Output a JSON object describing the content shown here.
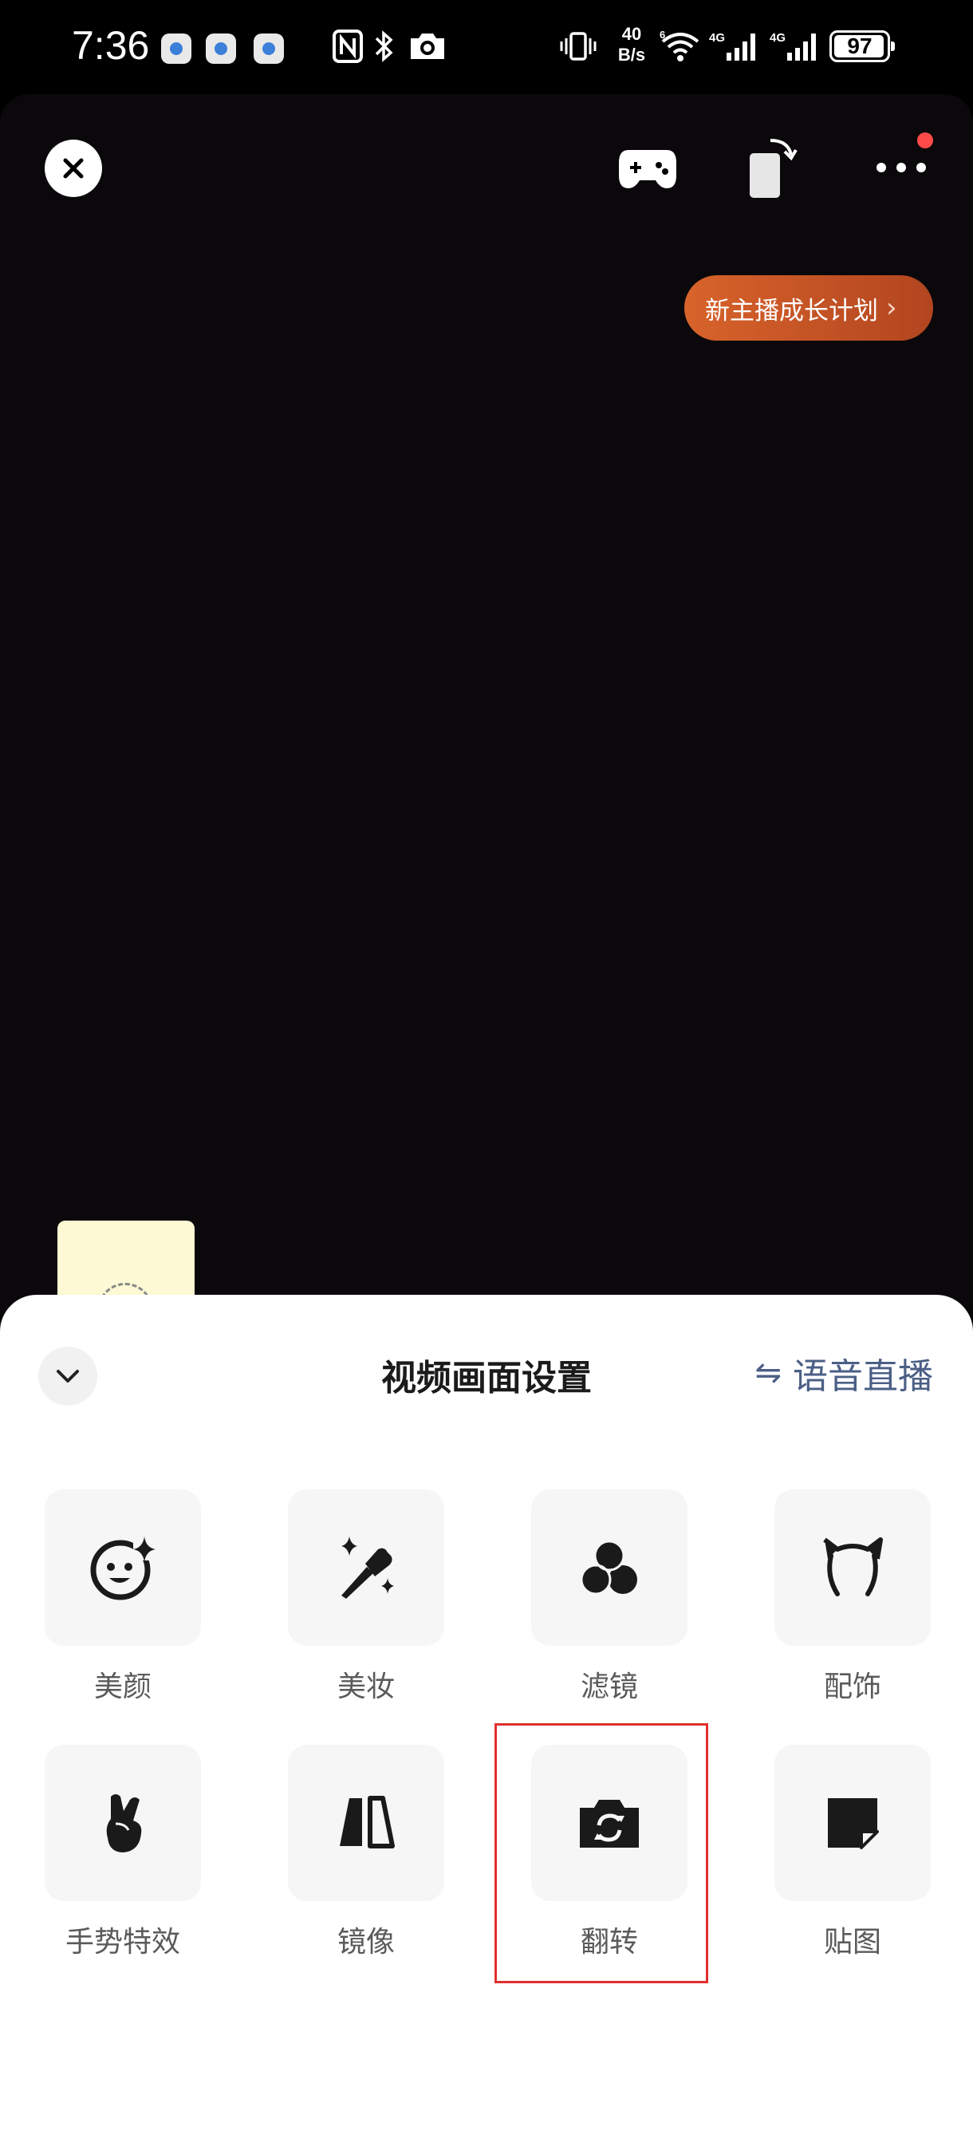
{
  "status_bar": {
    "time": "7:36",
    "net_speed_top": "40",
    "net_speed_bottom": "B/s",
    "wifi_label": "6",
    "sim1_label": "4G",
    "sim2_label": "4G",
    "battery": "97",
    "battery_level": 0.97
  },
  "top_bar": {
    "close_icon": "close-icon",
    "game_icon": "gamepad-icon",
    "rotate_icon": "rotate-screen-icon",
    "more_icon": "more-icon"
  },
  "promo": {
    "label": "新主播成长计划",
    "chevron": "›"
  },
  "sheet": {
    "title": "视频画面设置",
    "switch_label": "语音直播",
    "switch_glyph": "⇋",
    "tools": [
      {
        "label": "美颜",
        "icon": "beauty-face-icon"
      },
      {
        "label": "美妆",
        "icon": "makeup-brush-icon"
      },
      {
        "label": "滤镜",
        "icon": "filter-icon"
      },
      {
        "label": "配饰",
        "icon": "cat-ears-accessory-icon"
      },
      {
        "label": "手势特效",
        "icon": "finger-heart-gesture-icon"
      },
      {
        "label": "镜像",
        "icon": "mirror-icon"
      },
      {
        "label": "翻转",
        "icon": "camera-flip-icon"
      },
      {
        "label": "贴图",
        "icon": "sticker-icon"
      }
    ]
  },
  "colors": {
    "accent_red": "#e0302c",
    "promo_orange": "#d8632b",
    "link_blue": "#4b5f86"
  }
}
